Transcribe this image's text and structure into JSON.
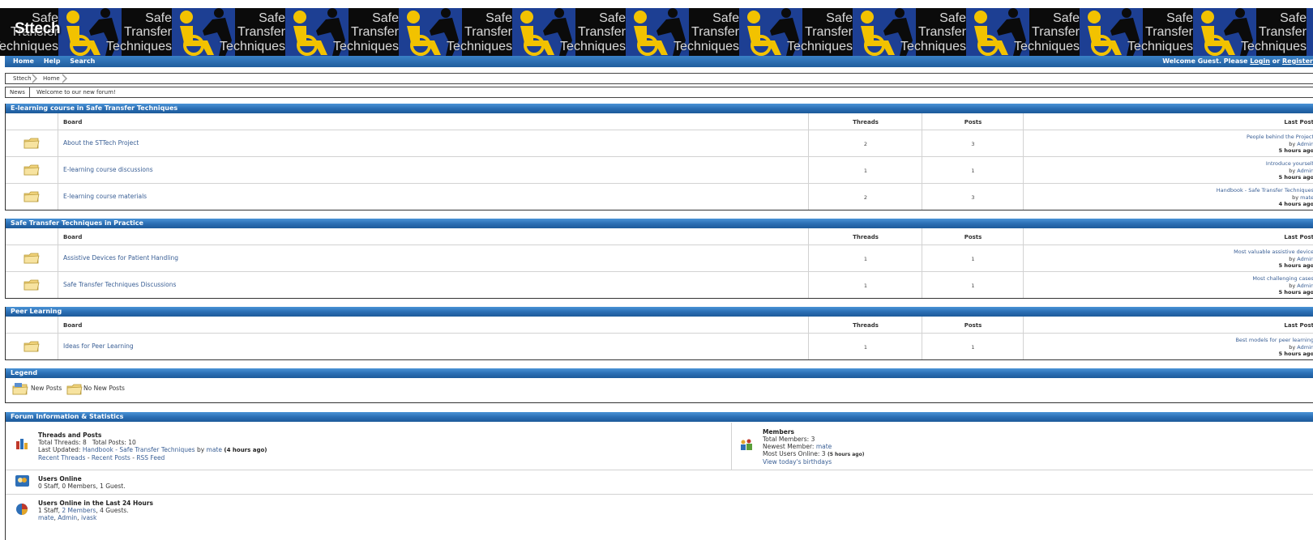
{
  "banner": {
    "site_name": "Sttech",
    "tile_line1": "Safe",
    "tile_line2": "Transfer",
    "tile_line3": "Techniques"
  },
  "nav": {
    "home": "Home",
    "help": "Help",
    "search": "Search",
    "welcome_prefix": "Welcome Guest. Please ",
    "login": "Login",
    "or": " or ",
    "register": "Register"
  },
  "breadcrumb": [
    "Sttech",
    "Home"
  ],
  "news": {
    "label": "News",
    "text": "Welcome to our new forum!"
  },
  "columns": {
    "board": "Board",
    "threads": "Threads",
    "posts": "Posts",
    "last_post": "Last Post"
  },
  "categories": [
    {
      "title": "E-learning course in Safe Transfer Techniques",
      "forums": [
        {
          "name": "About the STTech Project",
          "threads": "2",
          "posts": "3",
          "last_title": "People behind the Project",
          "by": "by ",
          "last_user": "Admin",
          "time": "5 hours ago"
        },
        {
          "name": "E-learning course discussions",
          "threads": "1",
          "posts": "1",
          "last_title": "Introduce yourself",
          "by": "by ",
          "last_user": "Admin",
          "time": "5 hours ago"
        },
        {
          "name": "E-learning course materials",
          "threads": "2",
          "posts": "3",
          "last_title": "Handbook - Safe Transfer Techniques",
          "by": "by ",
          "last_user": "mate",
          "time": "4 hours ago"
        }
      ]
    },
    {
      "title": "Safe Transfer Techniques in Practice",
      "forums": [
        {
          "name": "Assistive Devices for Patient Handling",
          "threads": "1",
          "posts": "1",
          "last_title": "Most valuable assistive device",
          "by": "by ",
          "last_user": "Admin",
          "time": "5 hours ago"
        },
        {
          "name": "Safe Transfer Techniques Discussions",
          "threads": "1",
          "posts": "1",
          "last_title": "Most challenging cases",
          "by": "by ",
          "last_user": "Admin",
          "time": "5 hours ago"
        }
      ]
    },
    {
      "title": "Peer Learning",
      "forums": [
        {
          "name": "Ideas for Peer Learning",
          "threads": "1",
          "posts": "1",
          "last_title": "Best models for peer learning",
          "by": "by ",
          "last_user": "Admin",
          "time": "5 hours ago"
        }
      ]
    }
  ],
  "legend": {
    "title": "Legend",
    "new_posts": "New Posts",
    "no_new_posts": "No New Posts"
  },
  "stats": {
    "title": "Forum Information & Statistics",
    "threads_posts": {
      "heading": "Threads and Posts",
      "totals": "Total Threads: 8   Total Posts: 10",
      "last_updated_prefix": "Last Updated: ",
      "last_updated_title": "Handbook - Safe Transfer Techniques",
      "last_updated_by": " by ",
      "last_updated_user": "mate",
      "last_updated_time": "(4 hours ago)",
      "recent_threads": "Recent Threads",
      "sep": " - ",
      "recent_posts": "Recent Posts",
      "rss": "RSS Feed"
    },
    "members": {
      "heading": "Members",
      "total": "Total Members: 3",
      "newest_prefix": "Newest Member: ",
      "newest_user": "mate",
      "most_online": "Most Users Online: 3",
      "most_online_time": "(5 hours ago)",
      "birthdays": "View today's birthdays"
    },
    "online": {
      "heading": "Users Online",
      "text": "0 Staff, 0 Members, 1 Guest."
    },
    "online24": {
      "heading": "Users Online in the Last 24 Hours",
      "text_prefix": "1 Staff, ",
      "members_link": "2 Members",
      "text_suffix": ", 4 Guests.",
      "users": [
        "mate",
        "Admin",
        "ivask"
      ]
    }
  }
}
